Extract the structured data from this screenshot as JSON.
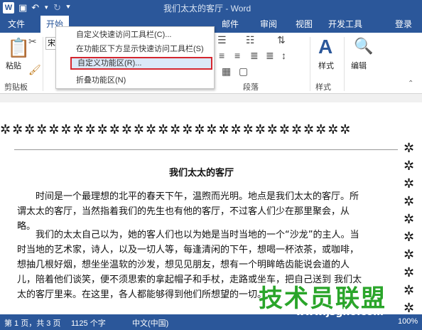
{
  "title": "我们太太的客厅 - Word",
  "tabs": {
    "file": "文件",
    "home": "开始",
    "mail": "邮件",
    "review": "审阅",
    "view": "视图",
    "dev": "开发工具",
    "login": "登录"
  },
  "ribbon": {
    "font_name": "宋",
    "paste": "粘贴",
    "clipboard": "剪贴板",
    "paragraph": "段落",
    "styles": "样式",
    "styles_group": "样式",
    "edit": "编辑"
  },
  "menu": {
    "items": [
      "自定义快速访问工具栏(C)...",
      "在功能区下方显示快速访问工具栏(S)",
      "自定义功能区(R)...",
      "折叠功能区(N)"
    ]
  },
  "document": {
    "title": "我们太太的客厅",
    "para1": "时间是一个最理想的北平的春天下午，温煦而光明。地点是我们太太的客厅。所谓太太的客厅，当然指着我们的先生也有他的客厅，不过客人们少在那里聚会，从略。",
    "para2": "我们的太太自己以为，她的客人们也以为她是当时当地的一个“沙龙”的主人。当时当地的艺术家，诗人，以及一切人等，每逢清闲的下午，想喝一杯浓茶，或咖啡，想抽几根好烟，想坐坐温软的沙发，想见见朋友，想有一个明眸皓齿能说会道的人儿，陪着他们谈笑，便不须思索的拿起帽子和手杖，走路或坐车，把自己送到 我们太太的客厅里来。在这里，各人都能够得到他们所想望的一切。"
  },
  "watermark": {
    "text": "技术员联盟",
    "url": "www.jsgho.com"
  },
  "status": {
    "page": "第 1 页，共 3 页",
    "words": "1125 个字",
    "lang": "中文(中国)",
    "zoom": "100%"
  }
}
